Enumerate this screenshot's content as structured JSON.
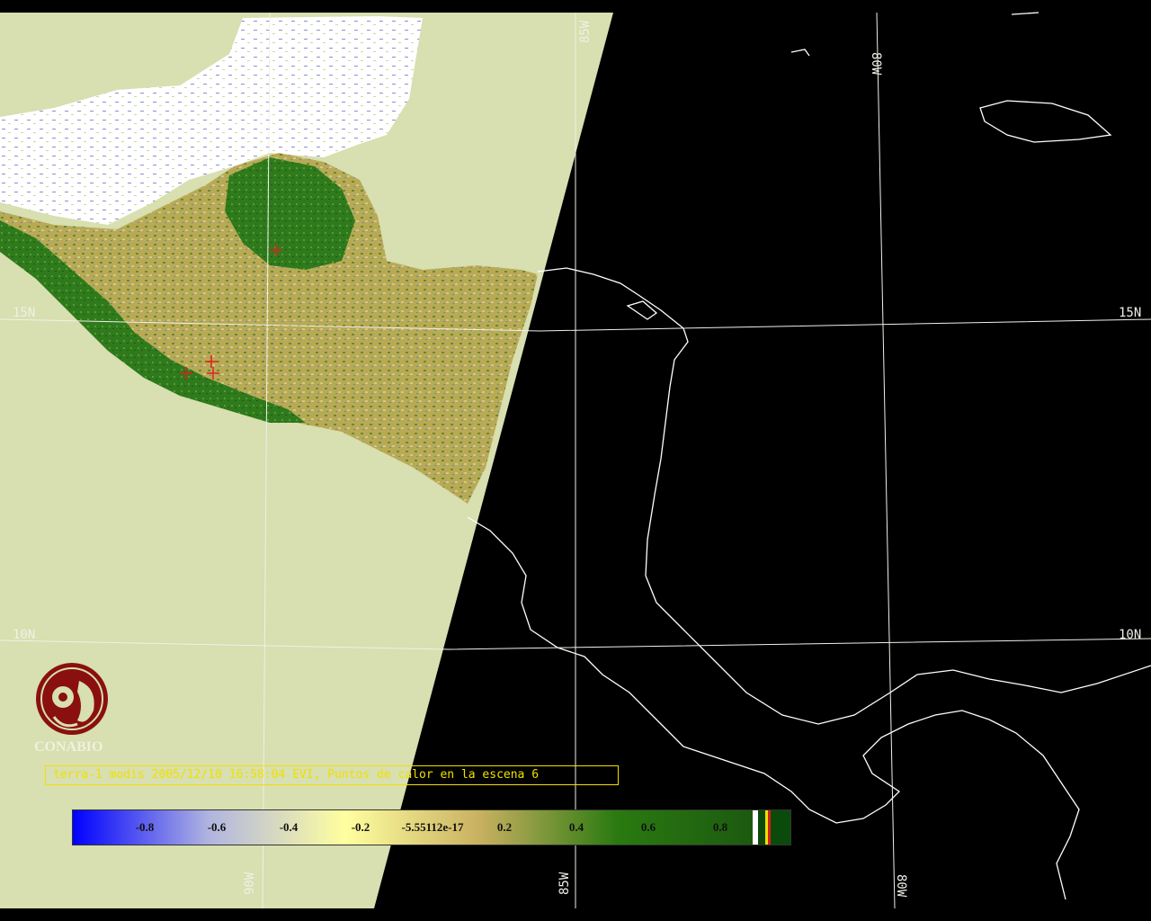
{
  "map": {
    "grid_labels": {
      "lat_15": "15N",
      "lat_15_right": "15N",
      "lat_10": "10N",
      "lat_10_right": "10N",
      "lon_85_top": "85W",
      "lon_80_top": "80W",
      "lon_90_bottom": "90W",
      "lon_85_bottom": "85W",
      "lon_80_bottom": "80W"
    },
    "hotspot_count_markers": 4,
    "colors": {
      "background_land": "#d8dfb0",
      "cloud": "#ffffff",
      "vegetation_high": "#2d7a1a",
      "vegetation_mid": "#b4a850",
      "night": "#000000",
      "hotspot": "#e02020",
      "grid": "#f0f0e8"
    }
  },
  "logo": {
    "name": "CONABIO",
    "icon": "conabio-macaw-logo"
  },
  "caption": {
    "text": "terra-1 modis 2005/12/10 16:58:04 EVI, Puntos de calor en la escena 6"
  },
  "colorbar": {
    "ticks": [
      "-0.8",
      "-0.6",
      "-0.4",
      "-0.2",
      "-5.55112e-17",
      "0.2",
      "0.4",
      "0.6",
      "0.8"
    ],
    "tick_values": [
      -0.8,
      -0.6,
      -0.4,
      -0.2,
      0,
      0.2,
      0.4,
      0.6,
      0.8
    ],
    "range": [
      -1,
      1
    ],
    "gradient_colors": [
      "#0000ff",
      "#b0b4e0",
      "#ffffa0",
      "#c8b060",
      "#2a7a10",
      "#1c5a10"
    ],
    "end_swatches": [
      "#ffffff",
      "#0a4a0a",
      "#f0e000",
      "#d02020"
    ]
  }
}
